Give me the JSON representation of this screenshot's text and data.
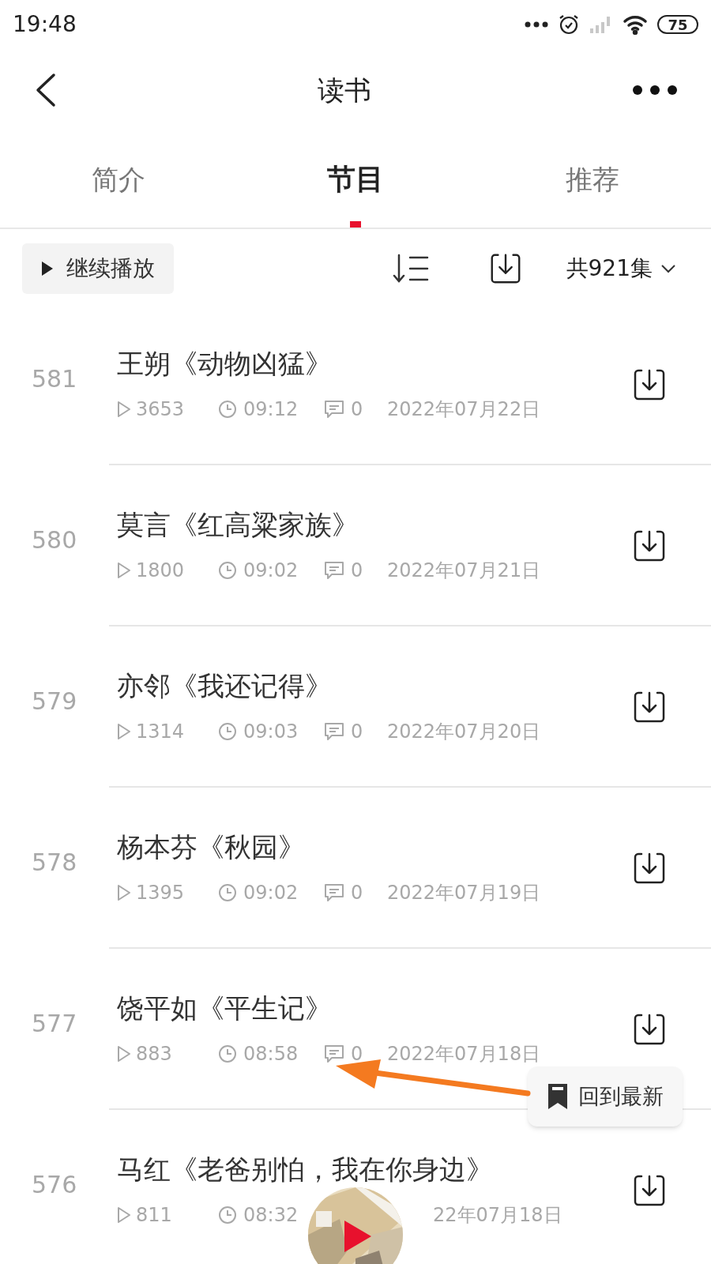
{
  "status_bar": {
    "time": "19:48",
    "battery": "75"
  },
  "header": {
    "title": "读书"
  },
  "tabs": [
    {
      "label": "简介",
      "selected": false
    },
    {
      "label": "节目",
      "selected": true
    },
    {
      "label": "推荐",
      "selected": false
    }
  ],
  "toolbar": {
    "continue_button": "继续播放",
    "count": "共921集"
  },
  "episodes": [
    {
      "number": "581",
      "title": "王朔《动物凶猛》",
      "plays": "3653",
      "duration": "09:12",
      "comments": "0",
      "date": "2022年07月22日"
    },
    {
      "number": "580",
      "title": "莫言《红高粱家族》",
      "plays": "1800",
      "duration": "09:02",
      "comments": "0",
      "date": "2022年07月21日"
    },
    {
      "number": "579",
      "title": "亦邻《我还记得》",
      "plays": "1314",
      "duration": "09:03",
      "comments": "0",
      "date": "2022年07月20日"
    },
    {
      "number": "578",
      "title": "杨本芬《秋园》",
      "plays": "1395",
      "duration": "09:02",
      "comments": "0",
      "date": "2022年07月19日"
    },
    {
      "number": "577",
      "title": "饶平如《平生记》",
      "plays": "883",
      "duration": "08:58",
      "comments": "0",
      "date": "2022年07月18日"
    },
    {
      "number": "576",
      "title": "马红《老爸别怕，我在你身边》",
      "plays": "811",
      "duration": "08:32",
      "date": "22年07月18日"
    }
  ],
  "float_button": {
    "label": "回到最新"
  }
}
